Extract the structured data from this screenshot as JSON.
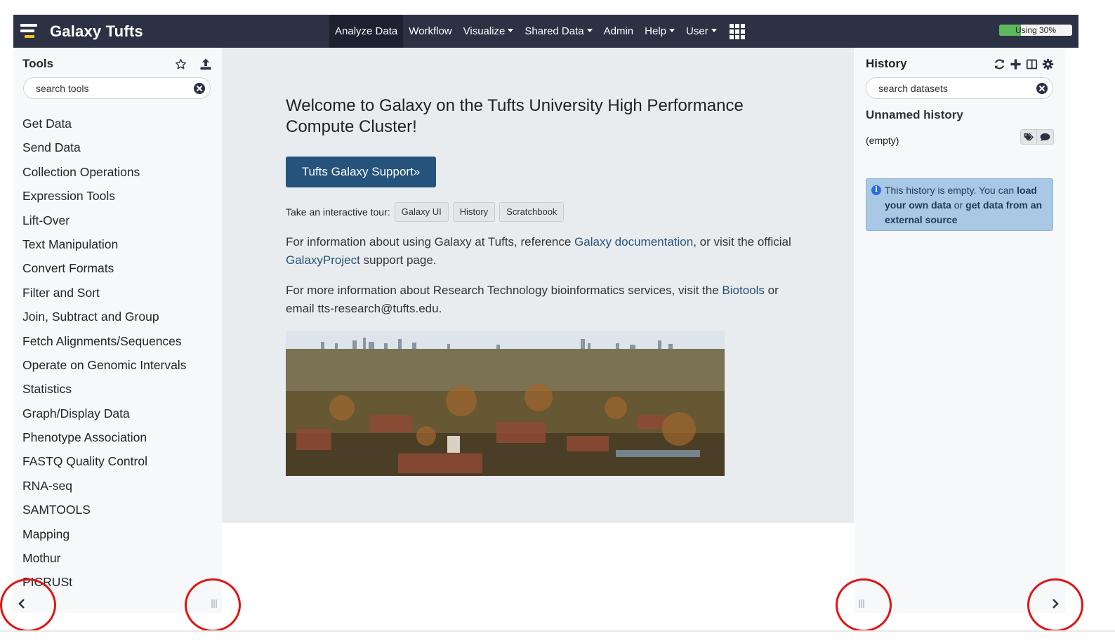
{
  "masthead": {
    "brand": "Galaxy Tufts",
    "nav": [
      {
        "label": "Analyze Data",
        "active": true,
        "dropdown": false
      },
      {
        "label": "Workflow",
        "active": false,
        "dropdown": false
      },
      {
        "label": "Visualize",
        "active": false,
        "dropdown": true
      },
      {
        "label": "Shared Data",
        "active": false,
        "dropdown": true
      },
      {
        "label": "Admin",
        "active": false,
        "dropdown": false
      },
      {
        "label": "Help",
        "active": false,
        "dropdown": true
      },
      {
        "label": "User",
        "active": false,
        "dropdown": true
      }
    ],
    "quota": {
      "label": "Using 30%",
      "percent": 30
    }
  },
  "tools": {
    "title": "Tools",
    "search_placeholder": "search tools",
    "items": [
      "Get Data",
      "Send Data",
      "Collection Operations",
      "Expression Tools",
      "Lift-Over",
      "Text Manipulation",
      "Convert Formats",
      "Filter and Sort",
      "Join, Subtract and Group",
      "Fetch Alignments/Sequences",
      "Operate on Genomic Intervals",
      "Statistics",
      "Graph/Display Data",
      "Phenotype Association",
      "FASTQ Quality Control",
      "RNA-seq",
      "SAMTOOLS",
      "Mapping",
      "Mothur",
      "PICRUSt"
    ]
  },
  "center": {
    "welcome": "Welcome to Galaxy on the Tufts University High Performance Compute Cluster!",
    "support_button": "Tufts Galaxy Support»",
    "tour_label": "Take an interactive tour:",
    "tours": [
      "Galaxy UI",
      "History",
      "Scratchbook"
    ],
    "para1": {
      "t1": "For information about using Galaxy at Tufts, reference ",
      "link1": "Galaxy documentation",
      "t2": ", or visit the official ",
      "link2": "GalaxyProject",
      "t3": " support page."
    },
    "para2": {
      "t1": "For more information about Research Technology bioinformatics services, visit the ",
      "link1": "Biotools",
      "t2": " or email tts-research@tufts.edu."
    }
  },
  "history": {
    "title": "History",
    "search_placeholder": "search datasets",
    "name": "Unnamed history",
    "size": "(empty)",
    "empty_msg": {
      "t1": "This history is empty. You can ",
      "link1": "load your own data",
      "t2": " or ",
      "link2": "get data from an external source"
    }
  },
  "colors": {
    "masthead_bg": "#2c3143",
    "primary": "#25537b",
    "panel_bg": "#f7f8f9",
    "center_bg": "#e9ecef",
    "alert_bg": "#a8c8e5",
    "annotation_red": "#e01414"
  },
  "icons": {
    "logo": "galaxy-logo-icon",
    "apps": "apps-grid-icon",
    "favorites": "star-icon",
    "upload": "upload-icon",
    "clear": "times-circle-icon",
    "refresh": "refresh-icon",
    "new_history": "plus-icon",
    "switch_history": "columns-icon",
    "history_options": "gear-icon",
    "tags": "tags-icon",
    "annotation": "comment-icon",
    "info": "info-icon",
    "collapse_left": "chevron-left-icon",
    "collapse_right": "chevron-right-icon"
  }
}
